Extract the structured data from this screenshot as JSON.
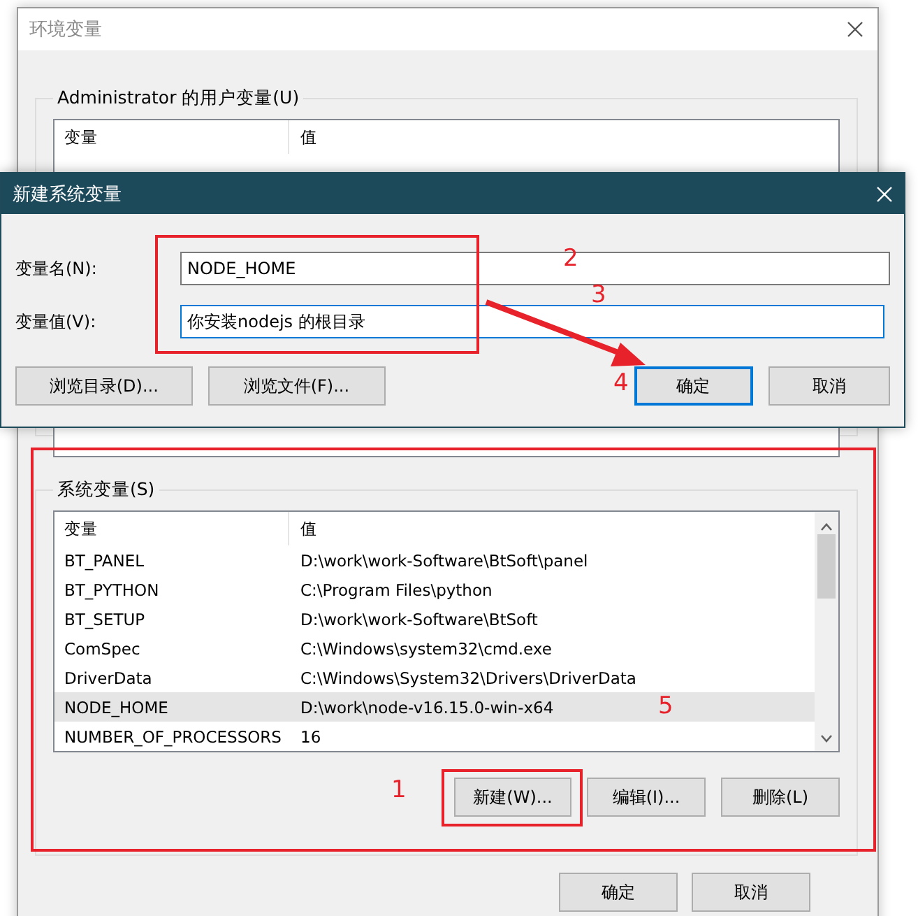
{
  "env_window": {
    "title": "环境变量",
    "user_vars": {
      "label": "Administrator 的用户变量(U)",
      "columns": [
        "变量",
        "值"
      ]
    },
    "system_vars": {
      "label": "系统变量(S)",
      "columns": [
        "变量",
        "值"
      ],
      "rows": [
        {
          "name": "BT_PANEL",
          "value": "D:\\work\\work-Software\\BtSoft\\panel",
          "selected": false
        },
        {
          "name": "BT_PYTHON",
          "value": "C:\\Program Files\\python",
          "selected": false
        },
        {
          "name": "BT_SETUP",
          "value": "D:\\work\\work-Software\\BtSoft",
          "selected": false
        },
        {
          "name": "ComSpec",
          "value": "C:\\Windows\\system32\\cmd.exe",
          "selected": false
        },
        {
          "name": "DriverData",
          "value": "C:\\Windows\\System32\\Drivers\\DriverData",
          "selected": false
        },
        {
          "name": "NODE_HOME",
          "value": "D:\\work\\node-v16.15.0-win-x64",
          "selected": true
        },
        {
          "name": "NUMBER_OF_PROCESSORS",
          "value": "16",
          "selected": false
        }
      ],
      "buttons": [
        "新建(W)...",
        "编辑(I)...",
        "删除(L)"
      ]
    },
    "buttons": [
      "确定",
      "取消"
    ]
  },
  "dialog": {
    "title": "新建系统变量",
    "fields": [
      {
        "label": "变量名(N):",
        "value": "NODE_HOME",
        "focused": false
      },
      {
        "label": "变量值(V):",
        "value": "你安装nodejs 的根目录",
        "focused": true
      }
    ],
    "buttons": [
      {
        "label": "浏览目录(D)...",
        "default": false
      },
      {
        "label": "浏览文件(F)...",
        "default": false
      },
      {
        "label": "确定",
        "default": true
      },
      {
        "label": "取消",
        "default": false
      }
    ]
  },
  "annotations": [
    "1",
    "2",
    "3",
    "4",
    "5"
  ]
}
